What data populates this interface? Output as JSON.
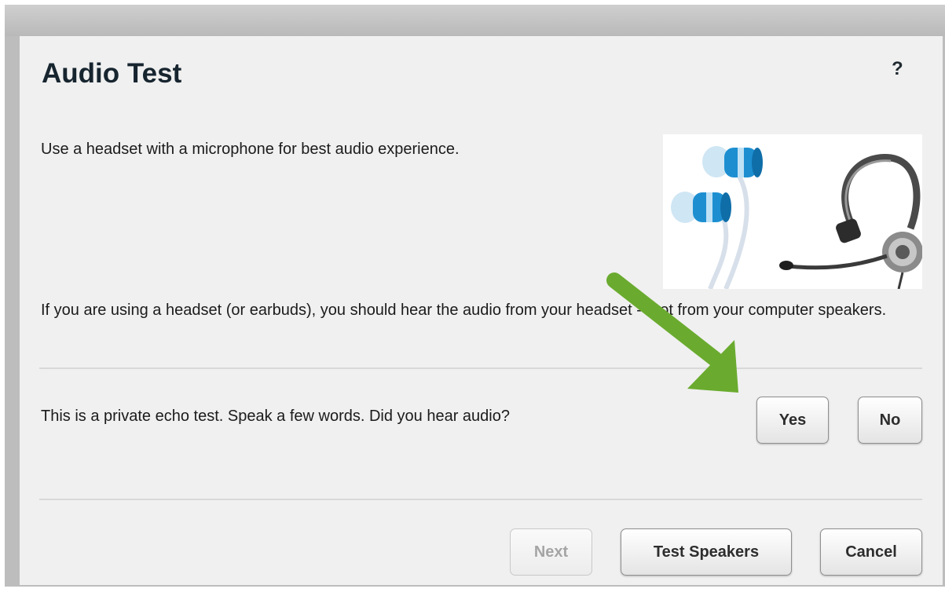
{
  "dialog": {
    "title": "Audio Test",
    "help_label": "?",
    "intro_text": "Use a headset with a microphone for best audio experience.",
    "headset_text": "If you are using a headset (or earbuds), you should hear the audio from your headset -- not from your computer speakers.",
    "echo_text": "This is a private echo test.  Speak a few words.  Did you hear audio?",
    "yes_label": "Yes",
    "no_label": "No",
    "next_label": "Next",
    "test_speakers_label": "Test Speakers",
    "cancel_label": "Cancel"
  },
  "image": {
    "icon": "headset-earbuds-image"
  },
  "colors": {
    "title": "#17252f",
    "dialog_bg": "#f0f0f0",
    "frame": "#bdbdbd",
    "arrow": "#6aab2f",
    "earbud_blue": "#1d8fd1"
  }
}
